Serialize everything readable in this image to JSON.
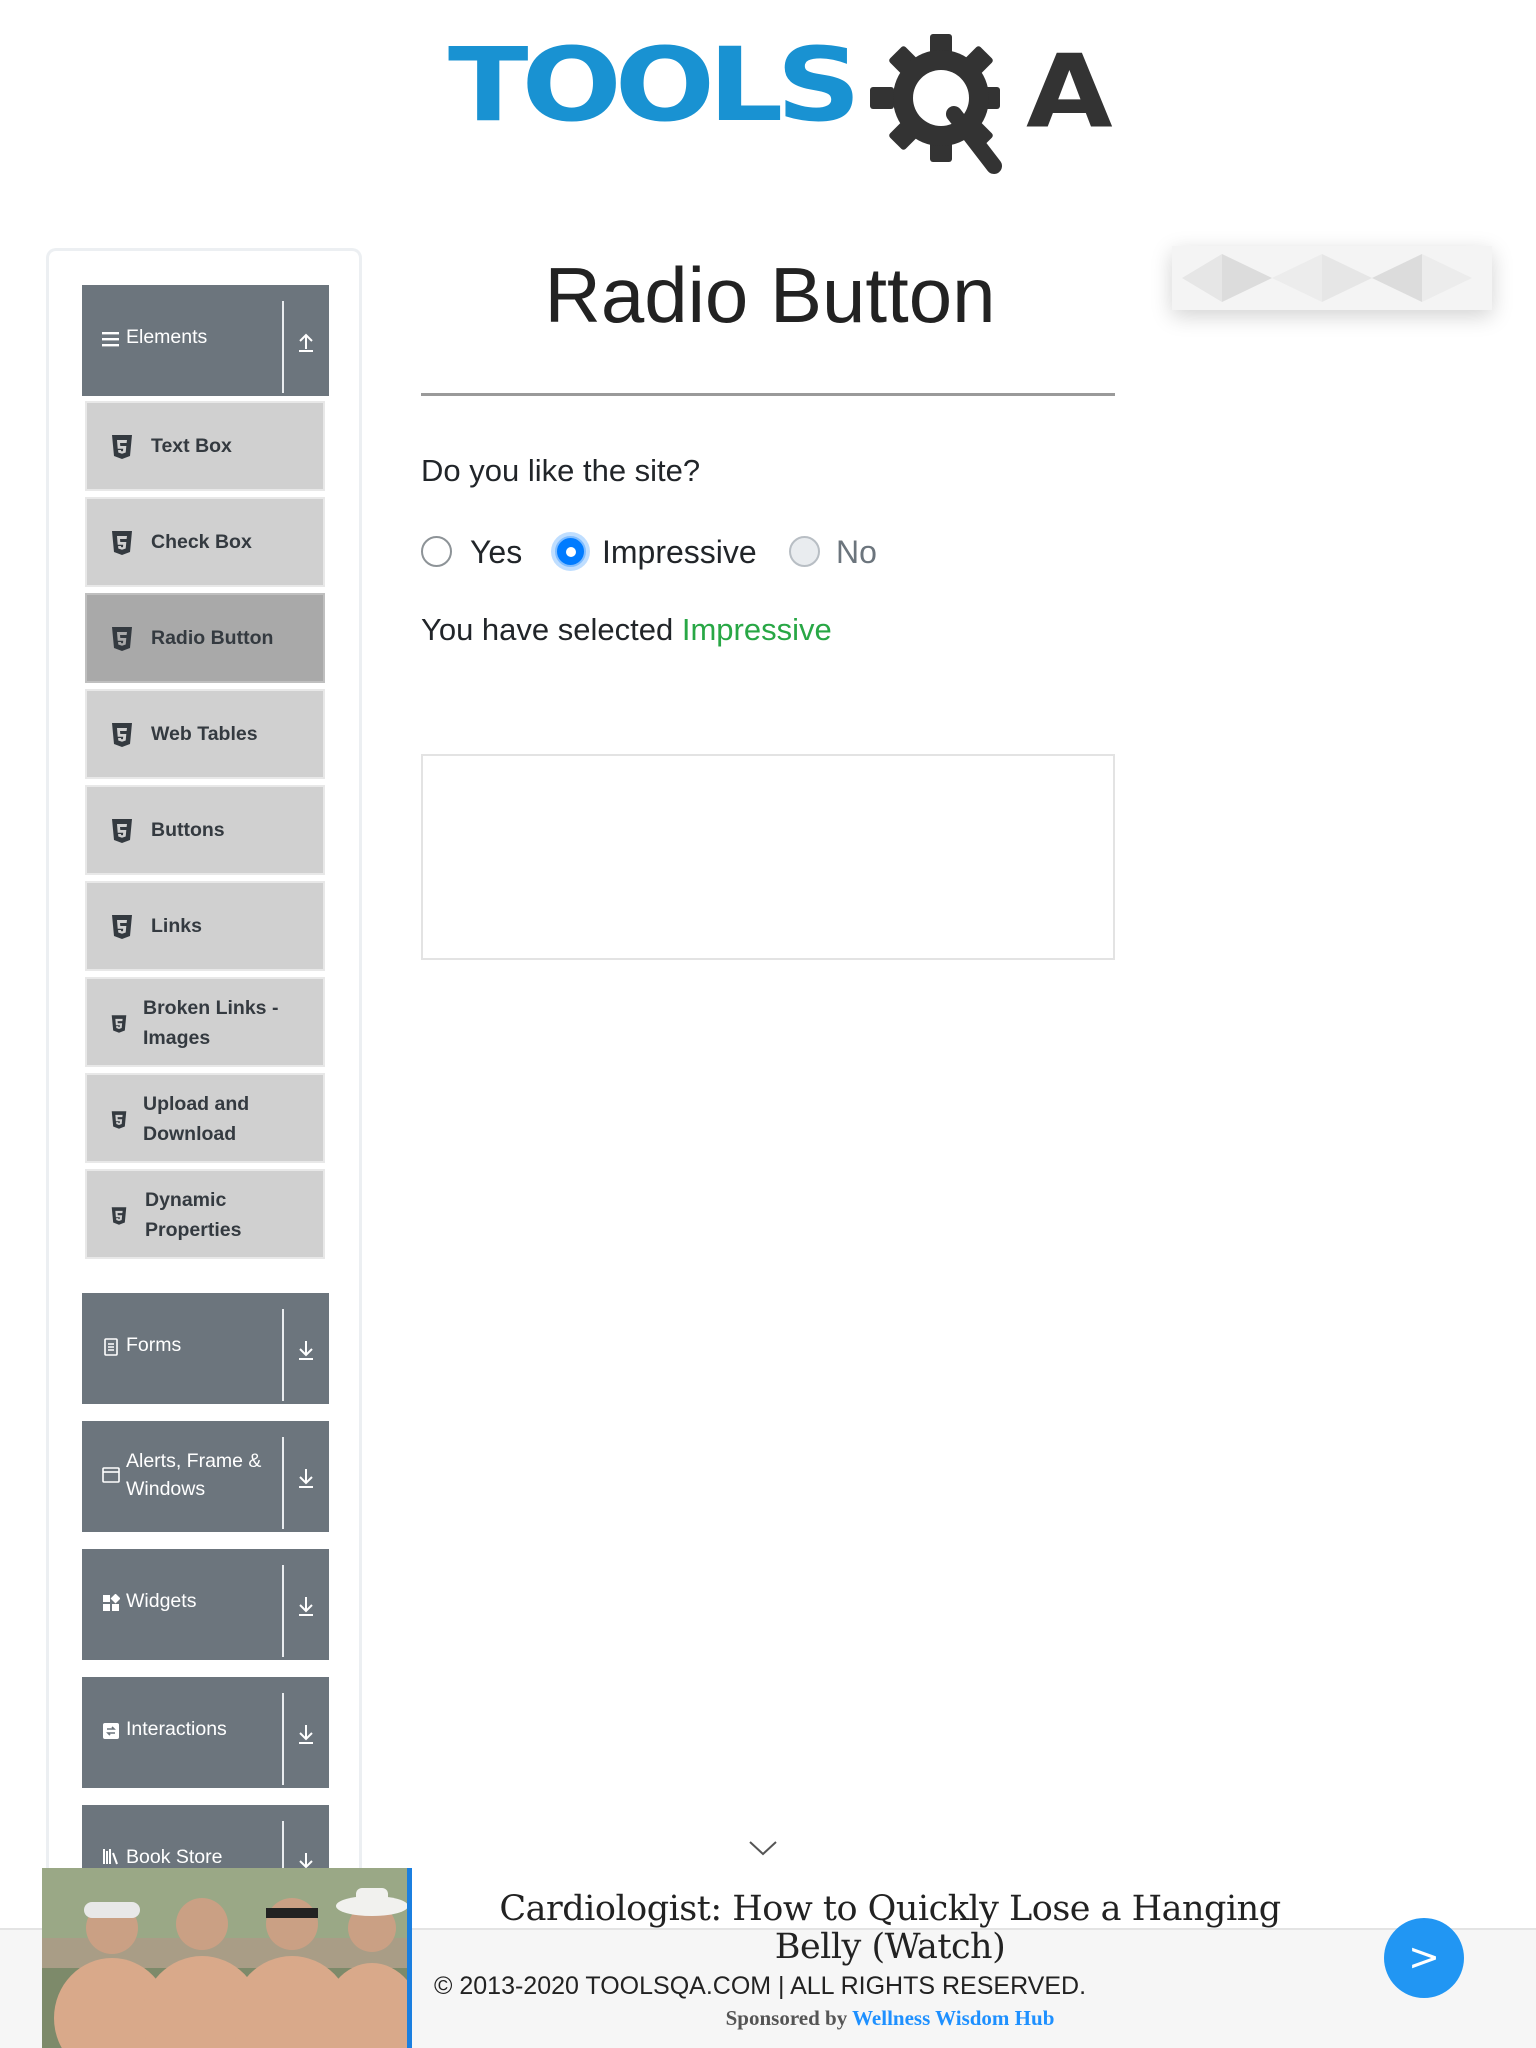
{
  "logo": {
    "text_main": "TOOLS",
    "text_end": "A"
  },
  "sidebar": {
    "elements": {
      "label": "Elements",
      "items": [
        {
          "label": "Text Box"
        },
        {
          "label": "Check Box"
        },
        {
          "label": "Radio Button",
          "active": true
        },
        {
          "label": "Web Tables"
        },
        {
          "label": "Buttons"
        },
        {
          "label": "Links"
        },
        {
          "label": "Broken Links - Images"
        },
        {
          "label": "Upload and Download"
        },
        {
          "label": "Dynamic Properties"
        }
      ]
    },
    "groups": [
      {
        "label": "Forms"
      },
      {
        "label": "Alerts, Frame & Windows"
      },
      {
        "label": "Widgets"
      },
      {
        "label": "Interactions"
      },
      {
        "label": "Book Store"
      }
    ]
  },
  "main": {
    "title": "Radio Button",
    "question": "Do you like the site?",
    "options": [
      {
        "label": "Yes",
        "checked": false,
        "disabled": false
      },
      {
        "label": "Impressive",
        "checked": true,
        "disabled": false
      },
      {
        "label": "No",
        "checked": false,
        "disabled": true
      }
    ],
    "result_prefix": "You have selected",
    "result_value": "Impressive"
  },
  "footer": {
    "text": "© 2013-2020 TOOLSQA.COM | ALL RIGHTS RESERVED."
  },
  "ad": {
    "headline": "Cardiologist: How to Quickly Lose a Hanging Belly (Watch)",
    "sponsor_prefix": "Sponsored by",
    "sponsor_name": "Wellness Wisdom Hub",
    "next_label": ">"
  },
  "colors": {
    "brand_blue": "#1992d2",
    "sidebar_header": "#6c757d",
    "menu_item": "#d0d0d0",
    "menu_item_active": "#a9a9a9",
    "success_green": "#28a745",
    "radio_checked": "#007bff"
  }
}
